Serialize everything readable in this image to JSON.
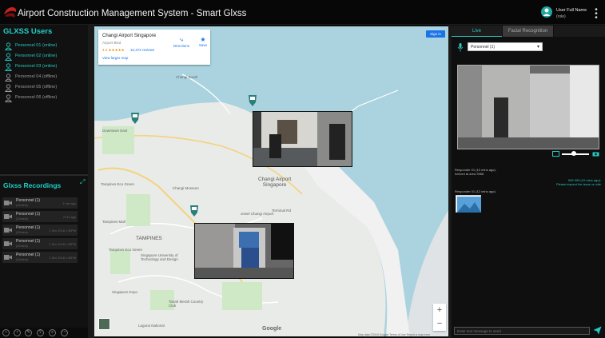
{
  "header": {
    "title": "Airport Construction Management System - Smart Glxss",
    "user_name": "User Full Name",
    "user_role": "(role)"
  },
  "users_panel": {
    "title": "GLXSS Users",
    "users": [
      {
        "label": "Personnel 01 (online)",
        "status": "online"
      },
      {
        "label": "Personnel 02 (online)",
        "status": "online"
      },
      {
        "label": "Personnel 03 (online)",
        "status": "online"
      },
      {
        "label": "Personnel 04 (offline)",
        "status": "offline"
      },
      {
        "label": "Personnel 05 (offline)",
        "status": "offline"
      },
      {
        "label": "Personnel 06 (offline)",
        "status": "offline"
      }
    ]
  },
  "recordings": {
    "title": "Glxss Recordings",
    "items": [
      {
        "name": "Personnel (1)",
        "sub": "(10mins)",
        "time": "1 min ago"
      },
      {
        "name": "Personnel (1)",
        "sub": "(10mins)",
        "time": "2 hrs ago"
      },
      {
        "name": "Personnel (1)",
        "sub": "(10mins)",
        "time": "1 Dec 2018 1:30PM"
      },
      {
        "name": "Personnel (1)",
        "sub": "(10mins)",
        "time": "1 Dec 2018 1:30PM"
      },
      {
        "name": "Personnel (1)",
        "sub": "(10mins)",
        "time": "1 Dec 2018 1:30PM"
      }
    ]
  },
  "map": {
    "place_title": "Changi Airport Singapore",
    "place_sub": "Airport Blvd",
    "rating": "4.4 ★★★★★",
    "reviews": "10,472 reviews",
    "larger_map": "View larger map",
    "directions": "Directions",
    "save": "Save",
    "signin": "Sign in",
    "labels": {
      "changi_south": "Changi South",
      "changi_airport": "Changi Airport\nSingapore",
      "tampines": "TAMPINES",
      "changi_museum": "Changi Museum",
      "tampines_mall": "Tampines Mall",
      "airport_blvd": "Airport Blvd",
      "downtown_east": "Downtown East",
      "tampines_eco": "Tampines Eco Green",
      "laguna": "Laguna National",
      "singapore_expo": "Singapore Expo",
      "tanah_merah": "Tanah Merah Country Club",
      "sutd": "Singapore University of Technology and Design",
      "jewel": "Jewel Changi Airport",
      "changi_airport_pier": "Changi Airport",
      "terminal": "Terminal Rd"
    },
    "google": "Google",
    "footer": "Map data ©2019 Google   Terms of Use   Report a map error",
    "zoom_in": "+",
    "zoom_out": "−"
  },
  "right_panel": {
    "tab_live": "Live",
    "tab_face": "Facial Recognition",
    "select_value": "Personnel (1)",
    "messages": [
      {
        "text": "Responder 01 (10 mins ago):",
        "side": "left"
      },
      {
        "text": "Arrived at area 3958",
        "side": "left"
      },
      {
        "text": "999 999 (10 mins ago):",
        "side": "right"
      },
      {
        "text": "Please inspect the issue on site",
        "side": "right"
      },
      {
        "text": "Responder 01 (12 mins ago):",
        "side": "left"
      }
    ],
    "input_placeholder": "Enter text message to send"
  }
}
